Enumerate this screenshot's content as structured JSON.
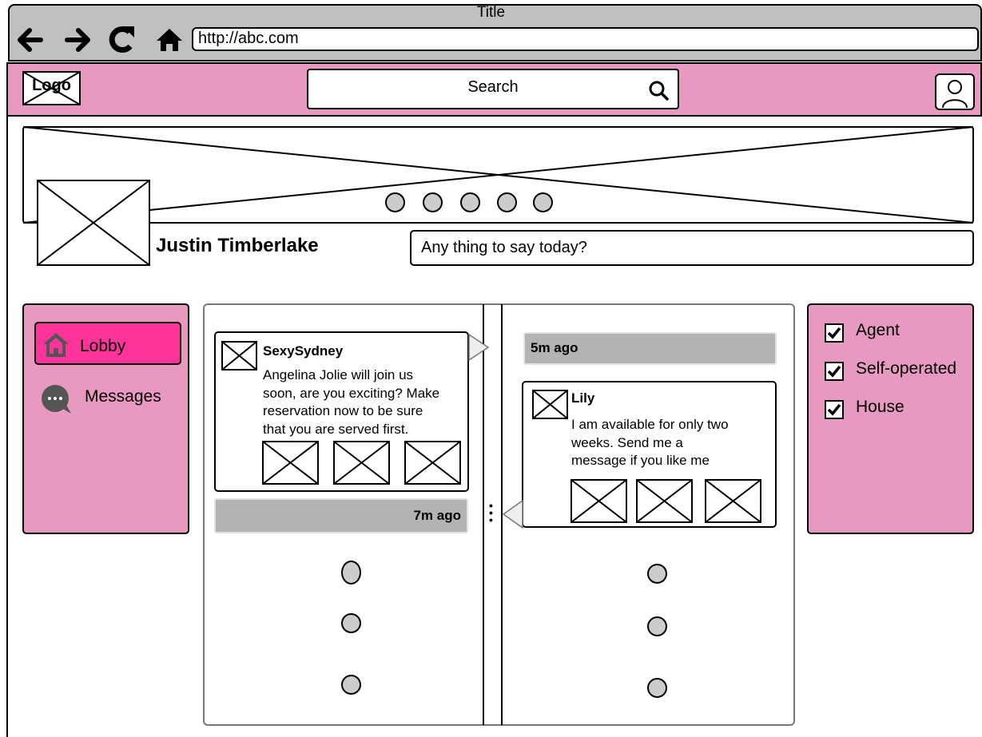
{
  "browser": {
    "title": "Title",
    "url": "http://abc.com"
  },
  "header": {
    "logo": "Logo",
    "search_placeholder": "Search"
  },
  "profile": {
    "name": "Justin Timberlake",
    "status_placeholder": "Any thing to say today?"
  },
  "sidebar": {
    "items": [
      {
        "label": "Lobby",
        "icon": "home-icon",
        "active": true
      },
      {
        "label": "Messages",
        "icon": "chat-bubble-icon",
        "active": false
      }
    ]
  },
  "filters": [
    {
      "label": "Agent",
      "checked": true
    },
    {
      "label": "Self-operated",
      "checked": true
    },
    {
      "label": "House",
      "checked": true
    }
  ],
  "timeline": {
    "left_post": {
      "author": "SexySydney",
      "text_lines": [
        "Angelina Jolie will join us",
        "soon, are you exciting? Make",
        "reservation now to be sure",
        "that you are served first."
      ],
      "time": "7m ago"
    },
    "right_post": {
      "author": "Lily",
      "text_lines": [
        "I am available for only two",
        "weeks. Send me a",
        "message if you like me"
      ],
      "time": "5m ago"
    }
  },
  "colors": {
    "chrome": "#c0c0c0",
    "header": "#e899c0",
    "panel": "#e899c0",
    "active_nav": "#ff3399",
    "timestamp_bar": "#b3b3b3",
    "dot": "#cccccc"
  }
}
